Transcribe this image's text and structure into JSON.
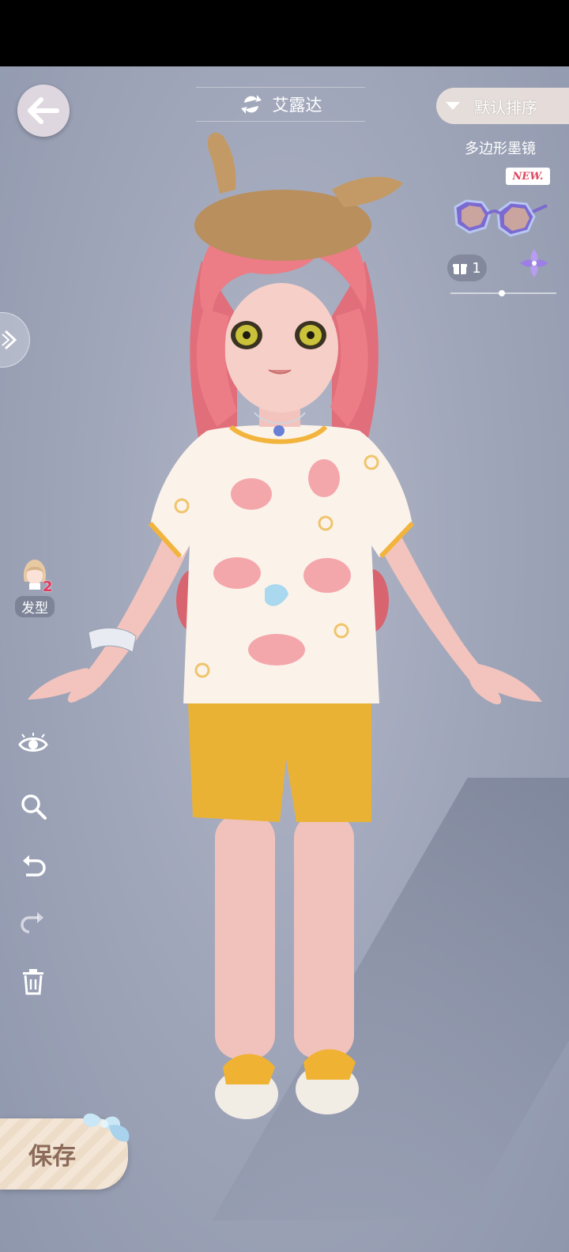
{
  "header": {
    "title": "艾露达",
    "sort_label": "默认排序"
  },
  "item": {
    "name": "多边形墨镜",
    "badge": "NEW.",
    "count": "1"
  },
  "sidebar": {
    "category_label": "发型",
    "category_badge": "2"
  },
  "footer": {
    "save_label": "保存"
  },
  "icons": [
    "back-arrow-icon",
    "refresh-icon",
    "sort-triangle-icon",
    "gift-box-icon",
    "purple-flower-icon",
    "expand-chevron-icon",
    "hair-avatar-icon",
    "eye-icon",
    "zoom-icon",
    "undo-icon",
    "redo-icon",
    "trash-icon",
    "ribbon-icon"
  ],
  "colors": {
    "hair": "#ec7c86",
    "shirt": "#fbf3ea",
    "shorts": "#e9b234",
    "hat": "#b98f5d",
    "new_badge_text": "#e0475f"
  }
}
